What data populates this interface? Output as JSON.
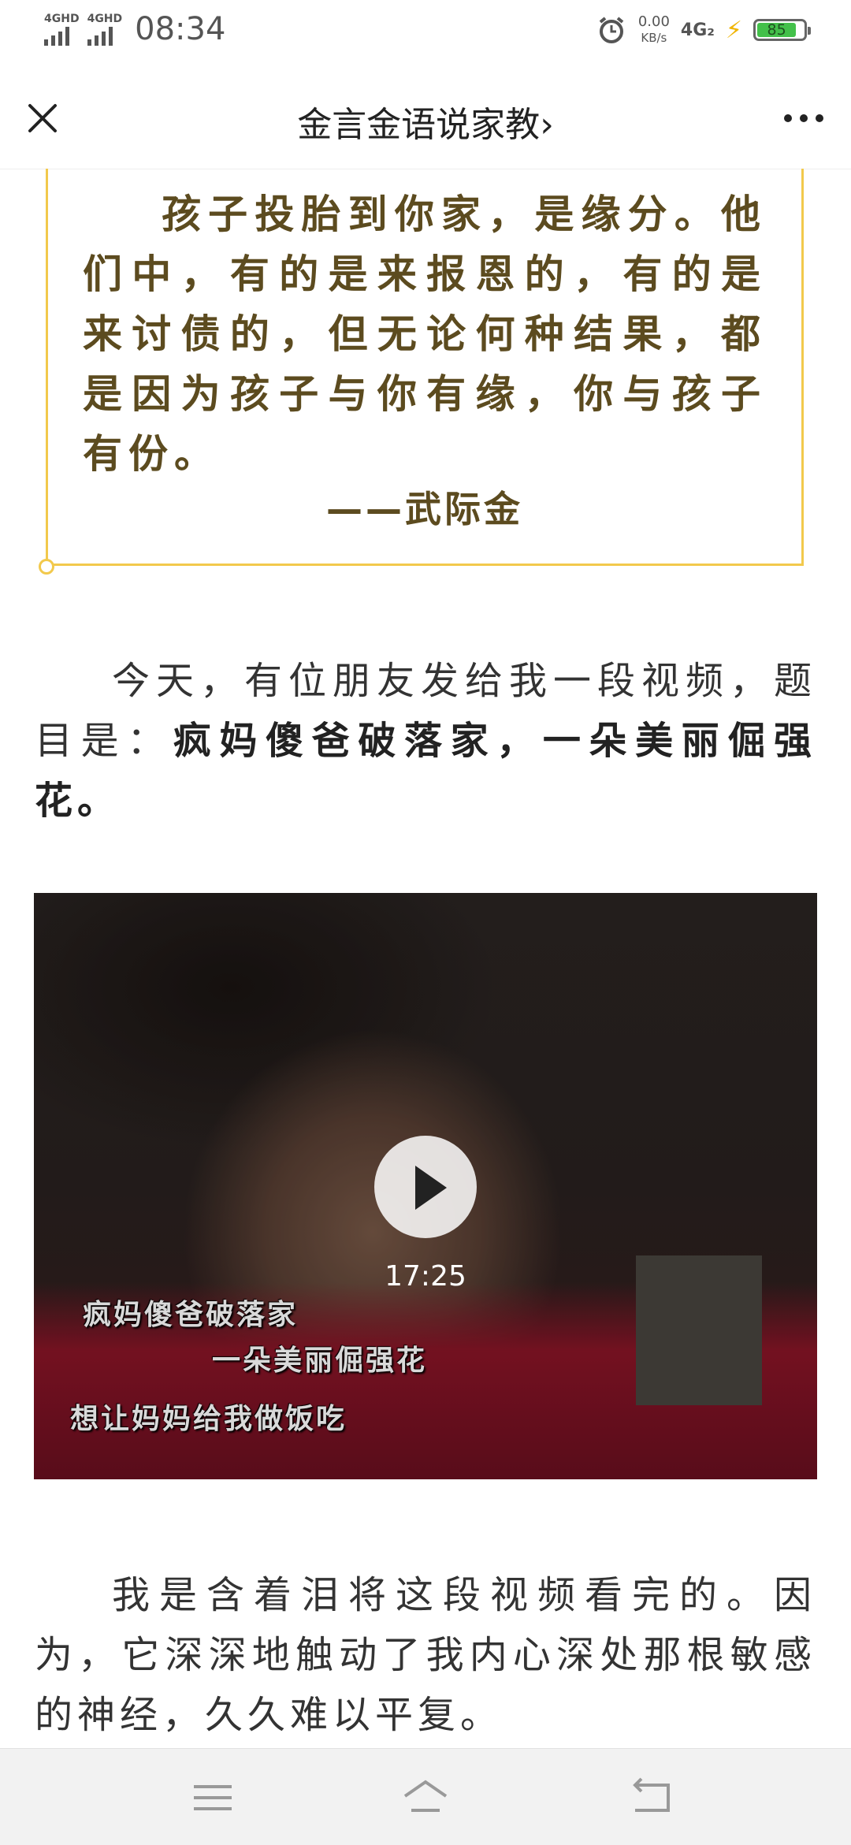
{
  "status_bar": {
    "signal1": "4GHD",
    "signal2": "4GHD",
    "time": "08:34",
    "speed_value": "0.00",
    "speed_unit": "KB/s",
    "network": "4G₂",
    "battery": "85",
    "battery_level": 0.85
  },
  "nav": {
    "title": "金言金语说家教",
    "chevron": "›"
  },
  "quote": {
    "text": "孩子投胎到你家，是缘分。他们中，有的是来报恩的，有的是来讨债的，但无论何种结果，都是因为孩子与你有缘，你与孩子有份。",
    "author": "——武际金"
  },
  "para1": {
    "prefix": "今天，有位朋友发给我一段视频，题目是：",
    "bold": "疯妈傻爸破落家，一朵美丽倔强花。"
  },
  "video": {
    "duration": "17:25",
    "subtitle1": "疯妈傻爸破落家",
    "subtitle2": "一朵美丽倔强花",
    "subtitle3": "想让妈妈给我做饭吃"
  },
  "para2": {
    "text": "我是含着泪将这段视频看完的。因为，它深深地触动了我内心深处那根敏感的神经，久久难以平复。"
  }
}
